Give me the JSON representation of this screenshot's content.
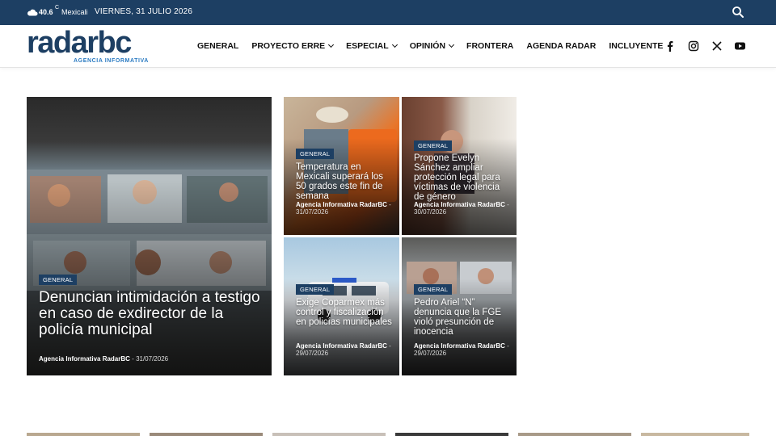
{
  "topbar": {
    "temperature": "40.6",
    "degree": "C",
    "city": "Mexicali",
    "date": "VIERNES, 31 JULIO 2026"
  },
  "header": {
    "logo_main": "radarbc",
    "logo_sub": "AGENCIA INFORMATIVA",
    "nav": [
      {
        "label": "GENERAL"
      },
      {
        "label": "PROYECTO ERRE"
      },
      {
        "label": "ESPECIAL"
      },
      {
        "label": "OPINIÓN"
      },
      {
        "label": "FRONTERA"
      },
      {
        "label": "AGENDA RADAR"
      },
      {
        "label": "INCLUYENTE"
      }
    ],
    "social_icons": [
      "facebook-icon",
      "instagram-icon",
      "x-icon",
      "youtube-icon"
    ]
  },
  "articles": [
    {
      "category": "GENERAL",
      "title": "Denuncian intimidación a testigo en caso de exdirector de la policía municipal",
      "author": "Agencia Informativa RadarBC",
      "separator": "-",
      "date": "31/07/2026"
    },
    {
      "category": "GENERAL",
      "title": "Temperatura en Mexicali superará los 50 grados este fin de semana",
      "author": "Agencia Informativa RadarBC",
      "separator": "-",
      "date": "31/07/2026"
    },
    {
      "category": "GENERAL",
      "title": "Propone Evelyn Sánchez ampliar protección legal para víctimas de violencia de género",
      "author": "Agencia Informativa RadarBC",
      "separator": "-",
      "date": "30/07/2026"
    },
    {
      "category": "GENERAL",
      "title": "Exige Coparmex más control y fiscalización en policías municipales",
      "author": "Agencia Informativa RadarBC",
      "separator": "-",
      "date": "29/07/2026"
    },
    {
      "category": "GENERAL",
      "title": "Pedro Ariel “N” denuncia que la FGE violó presunción de inocencia",
      "author": "Agencia Informativa RadarBC",
      "separator": "-",
      "date": "29/07/2026"
    }
  ],
  "colors": {
    "brand": "#1d3f63",
    "accent": "#2b7bc2"
  }
}
